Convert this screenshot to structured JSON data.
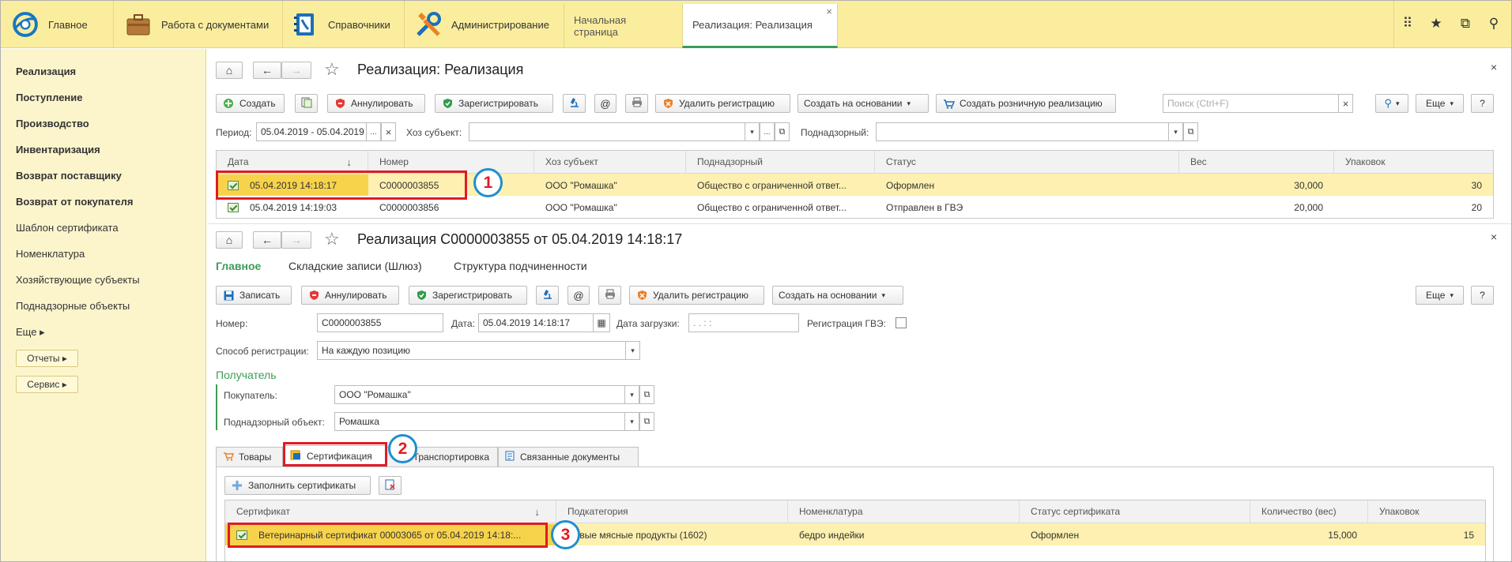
{
  "topbar": {
    "sections": [
      {
        "label": "Главное",
        "icon": "home-logo-icon"
      },
      {
        "label": "Работа с документами",
        "icon": "briefcase-icon"
      },
      {
        "label": "Справочники",
        "icon": "phonebook-icon"
      },
      {
        "label": "Администрирование",
        "icon": "tools-icon"
      }
    ],
    "open_tabs": [
      {
        "label": "Начальная страница"
      },
      {
        "label": "Реализация: Реализация",
        "close": "×"
      }
    ],
    "right_icons": [
      "apps-grid-icon",
      "star-icon",
      "history-icon",
      "search-icon"
    ],
    "glyphs": {
      "apps": "⠿",
      "star": "★",
      "history": "⧉",
      "search": "⚲"
    }
  },
  "sidebar": {
    "items": [
      {
        "label": "Реализация",
        "bold": true
      },
      {
        "label": "Поступление",
        "bold": true
      },
      {
        "label": "Производство",
        "bold": true
      },
      {
        "label": "Инвентаризация",
        "bold": true
      },
      {
        "label": "Возврат поставщику",
        "bold": true
      },
      {
        "label": "Возврат от покупателя",
        "bold": true
      },
      {
        "label": "Шаблон сертификата",
        "bold": false
      },
      {
        "label": "Номенклатура",
        "bold": false
      },
      {
        "label": "Хозяйствующие субъекты",
        "bold": false
      },
      {
        "label": "Поднадзорные объекты",
        "bold": false
      },
      {
        "label": "Еще ▸",
        "bold": false
      }
    ],
    "buttons": [
      "Отчеты ▸",
      "Сервис ▸"
    ]
  },
  "list_form": {
    "title": "Реализация: Реализация",
    "close": "×",
    "nav": {
      "home": "⌂",
      "back": "←",
      "forward": "→",
      "star": "☆"
    },
    "toolbar": {
      "create": "Создать",
      "annul": "Аннулировать",
      "register": "Зарегистрировать",
      "delete_reg": "Удалить регистрацию",
      "create_basis": "Создать на основании",
      "create_retail": "Создать розничную реализацию",
      "search_placeholder": "Поиск (Ctrl+F)",
      "more": "Еще",
      "help": "?",
      "at": "@",
      "dropdown": "▾",
      "clear": "×",
      "search_glyph": "⚲"
    },
    "filters": {
      "period_label": "Период:",
      "period_value": "05.04.2019 - 05.04.2019",
      "subject_label": "Хоз субъект:",
      "subject_value": "",
      "supervised_label": "Поднадзорный:",
      "supervised_value": "",
      "ellipsis": "...",
      "clear": "×",
      "dropdown": "▾",
      "open": "⧉"
    },
    "columns": [
      "Дата",
      "Номер",
      "Хоз субъект",
      "Поднадзорный",
      "Статус",
      "Вес",
      "Упаковок"
    ],
    "sort_arrow": "↓",
    "rows": [
      {
        "date": "05.04.2019 14:18:17",
        "number": "С0000003855",
        "subject": "ООО \"Ромашка\"",
        "supervised": "Общество с ограниченной ответ...",
        "status": "Оформлен",
        "weight": "30,000",
        "packs": "30"
      },
      {
        "date": "05.04.2019 14:19:03",
        "number": "С0000003856",
        "subject": "ООО \"Ромашка\"",
        "supervised": "Общество с ограниченной ответ...",
        "status": "Отправлен в ГВЭ",
        "weight": "20,000",
        "packs": "20"
      }
    ]
  },
  "doc_form": {
    "title": "Реализация С0000003855 от 05.04.2019 14:18:17",
    "close": "×",
    "nav": {
      "home": "⌂",
      "back": "←",
      "forward": "→",
      "star": "☆"
    },
    "nav_tabs": [
      "Главное",
      "Складские записи (Шлюз)",
      "Структура подчиненности"
    ],
    "toolbar": {
      "save": "Записать",
      "annul": "Аннулировать",
      "register": "Зарегистрировать",
      "delete_reg": "Удалить регистрацию",
      "create_basis": "Создать на основании",
      "more": "Еще",
      "help": "?",
      "at": "@",
      "dropdown": "▾"
    },
    "fields": {
      "number_label": "Номер:",
      "number_value": "С0000003855",
      "date_label": "Дата:",
      "date_value": "05.04.2019 14:18:17",
      "load_date_label": "Дата загрузки:",
      "load_date_value": " .  .       :  :",
      "gve_label": "Регистрация ГВЭ:",
      "reg_method_label": "Способ регистрации:",
      "reg_method_value": "На каждую позицию",
      "recipient_heading": "Получатель",
      "buyer_label": "Покупатель:",
      "buyer_value": "ООО \"Ромашка\"",
      "object_label": "Поднадзорный объект:",
      "object_value": "Ромашка",
      "calendar": "▦",
      "dropdown": "▾",
      "open": "⧉"
    },
    "tabs": [
      "Товары",
      "Сертификация",
      "Транспортировка",
      "Связанные документы"
    ],
    "cert_toolbar": {
      "fill": "Заполнить сертификаты"
    },
    "cert_columns": [
      "Сертификат",
      "Подкатегория",
      "Номенклатура",
      "Статус сертификата",
      "Количество (вес)",
      "Упаковок"
    ],
    "sort_arrow": "↓",
    "cert_rows": [
      {
        "cert": "Ветеринарный сертификат 00003065 от 05.04.2019 14:18:...",
        "subcat": "Новые мясные продукты (1602)",
        "nomen": "бедро индейки",
        "status": "Оформлен",
        "qty": "15,000",
        "packs": "15"
      }
    ]
  },
  "annotations": [
    "1",
    "2",
    "3"
  ],
  "colors": {
    "accent_green": "#3d9c56",
    "highlight": "#fdf0b0",
    "marker_red": "#e01b24",
    "marker_blue": "#1e8fd0",
    "topbar": "#fbed9e",
    "sidebar": "#fcf5cc"
  }
}
